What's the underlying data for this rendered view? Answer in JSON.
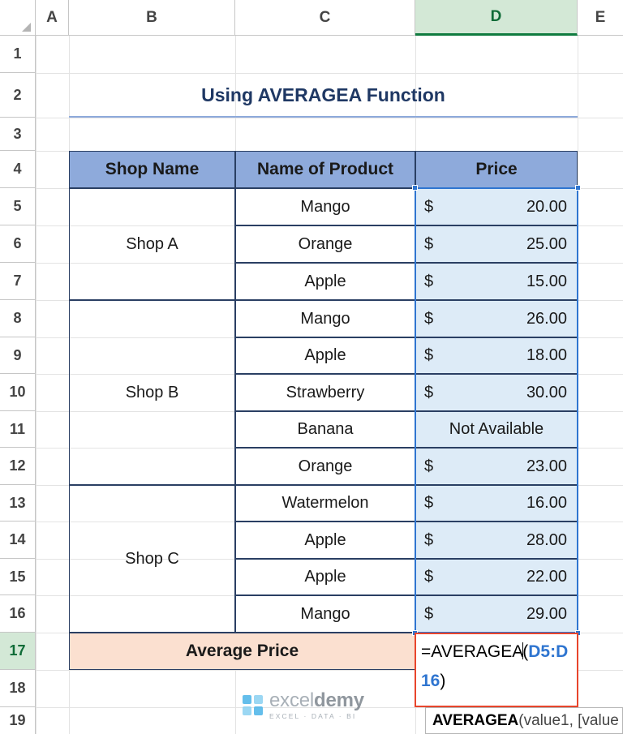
{
  "app": {
    "name": "spreadsheet",
    "columns": [
      "A",
      "B",
      "C",
      "D",
      "E"
    ],
    "selected_column": "D",
    "rows": [
      "1",
      "2",
      "3",
      "4",
      "5",
      "6",
      "7",
      "8",
      "9",
      "10",
      "11",
      "12",
      "13",
      "14",
      "15",
      "16",
      "17",
      "18",
      "19"
    ],
    "highlighted_row": "17"
  },
  "title": {
    "text": "Using AVERAGEA Function"
  },
  "table": {
    "headers": [
      "Shop Name",
      "Name of Product",
      "Price"
    ],
    "rows": [
      {
        "shop": "Shop A",
        "product": "Mango",
        "currency": "$",
        "amount": "20.00",
        "price_text": ""
      },
      {
        "shop": "",
        "product": "Orange",
        "currency": "$",
        "amount": "25.00",
        "price_text": ""
      },
      {
        "shop": "",
        "product": "Apple",
        "currency": "$",
        "amount": "15.00",
        "price_text": ""
      },
      {
        "shop": "Shop B",
        "product": "Mango",
        "currency": "$",
        "amount": "26.00",
        "price_text": ""
      },
      {
        "shop": "",
        "product": "Apple",
        "currency": "$",
        "amount": "18.00",
        "price_text": ""
      },
      {
        "shop": "",
        "product": "Strawberry",
        "currency": "$",
        "amount": "30.00",
        "price_text": ""
      },
      {
        "shop": "",
        "product": "Banana",
        "currency": "",
        "amount": "",
        "price_text": "Not Available"
      },
      {
        "shop": "",
        "product": "Orange",
        "currency": "$",
        "amount": "23.00",
        "price_text": ""
      },
      {
        "shop": "Shop C",
        "product": "Watermelon",
        "currency": "$",
        "amount": "16.00",
        "price_text": ""
      },
      {
        "shop": "",
        "product": "Apple",
        "currency": "$",
        "amount": "28.00",
        "price_text": ""
      },
      {
        "shop": "",
        "product": "Apple",
        "currency": "$",
        "amount": "22.00",
        "price_text": ""
      },
      {
        "shop": "",
        "product": "Mango",
        "currency": "$",
        "amount": "29.00",
        "price_text": ""
      }
    ],
    "footer_label": "Average Price"
  },
  "formula_cell": {
    "prefix": "=AVERAGEA",
    "open_paren": "(",
    "range_part1": "D5:",
    "range_part2": "D16",
    "close_paren": ")"
  },
  "tooltip": {
    "function_name": "AVERAGEA",
    "signature": "(value1, [value"
  },
  "watermark": {
    "brand_light": "excel",
    "brand_bold": "demy",
    "tagline": "EXCEL · DATA · BI"
  },
  "colors": {
    "header_fill": "#8EAADB",
    "price_fill": "#DDEBF7",
    "footer_fill": "#FBE0D0",
    "border": "#2A3F63",
    "title": "#1F3864",
    "selection": "#2F75D0",
    "edit_border": "#E8452C",
    "sheet_tab_green": "#0F7B3F"
  }
}
